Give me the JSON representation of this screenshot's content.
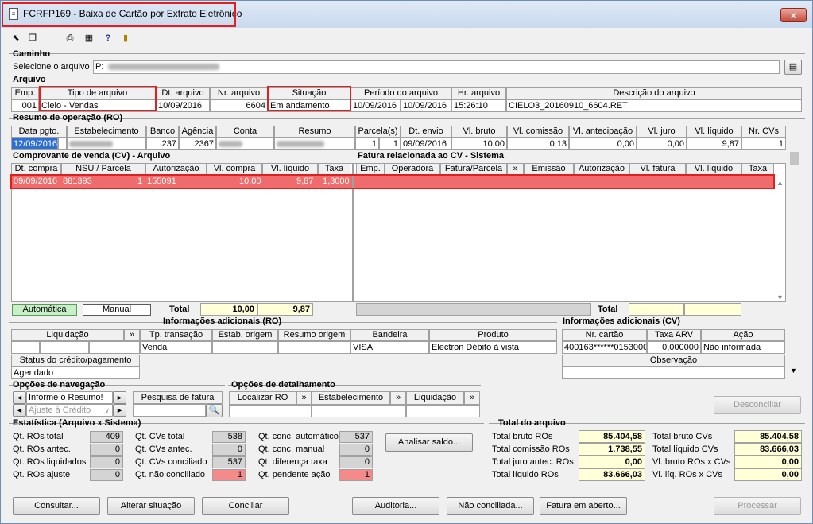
{
  "window": {
    "title": "FCRFP169 - Baixa de Cartão por Extrato Eletrônico",
    "close": "x"
  },
  "caminho": {
    "section": "Caminho",
    "label": "Selecione o arquivo",
    "value": "P:"
  },
  "arquivo": {
    "section": "Arquivo",
    "headers": [
      "Emp.",
      "Tipo de arquivo",
      "Dt. arquivo",
      "Nr. arquivo",
      "Situação",
      "Período do arquivo",
      "Hr. arquivo",
      "Descrição do arquivo"
    ],
    "row": {
      "emp": "001",
      "tipo": "Cielo - Vendas",
      "dt": "10/09/2016",
      "nr": "6604",
      "situacao": "Em andamento",
      "periodo_ini": "10/09/2016",
      "periodo_fim": "10/09/2016",
      "hr": "15:26:10",
      "descricao": "CIELO3_20160910_6604.RET"
    }
  },
  "ro": {
    "section": "Resumo de operação (RO)",
    "headers": [
      "Data pgto.",
      "Estabelecimento",
      "Banco",
      "Agência",
      "Conta",
      "Resumo",
      "Parcela(s)",
      "Dt. envio",
      "Vl. bruto",
      "Vl. comissão",
      "Vl. antecipação",
      "Vl. juro",
      "Vl. líquido",
      "Nr. CVs"
    ],
    "row": {
      "data": "12/09/2016",
      "banco": "237",
      "agencia": "2367",
      "parcela1": "1",
      "parcela2": "1",
      "dt_envio": "09/09/2016",
      "bruto": "10,00",
      "comissao": "0,13",
      "antecipacao": "0,00",
      "juro": "0,00",
      "liquido": "9,87",
      "nr_cvs": "1"
    }
  },
  "cv": {
    "section": "Comprovante de venda (CV) - Arquivo",
    "headers": [
      "Dt. compra",
      "NSU / Parcela",
      "Autorização",
      "Vl. compra",
      "Vl. líquido",
      "Taxa"
    ],
    "row": {
      "dt": "09/09/2016",
      "nsu": "881393",
      "parcela": "1",
      "autorizacao": "155091",
      "compra": "10,00",
      "liquido": "9,87",
      "taxa": "1,3000"
    },
    "automatica": "Automática",
    "manual": "Manual",
    "total_label": "Total",
    "total_compra": "10,00",
    "total_liquido": "9,87"
  },
  "fatura": {
    "section": "Fatura relacionada ao CV - Sistema",
    "headers": [
      "Emp.",
      "Operadora",
      "Fatura/Parcela",
      "»",
      "Emissão",
      "Autorização",
      "Vl. fatura",
      "Vl. líquido",
      "Taxa"
    ],
    "total_label": "Total"
  },
  "info_ro": {
    "section": "Informações adicionais (RO)",
    "headers": [
      "Liquidação",
      "»",
      "Tp. transação",
      "Estab. origem",
      "Resumo origem",
      "Bandeira",
      "Produto"
    ],
    "row": {
      "tp": "Venda",
      "bandeira": "VISA",
      "produto": "Electron Débito à vista"
    },
    "status_label": "Status do crédito/pagamento",
    "status": "Agendado"
  },
  "info_cv": {
    "section": "Informações adicionais (CV)",
    "headers": [
      "Nr. cartão",
      "Taxa ARV",
      "Ação"
    ],
    "row": {
      "cartao": "400163******0153000",
      "taxa": "0,000000",
      "acao": "Não informada"
    },
    "obs_label": "Observação"
  },
  "nav": {
    "section": "Opções de navegação",
    "item1": "Informe o Resumo!",
    "item2": "Ajuste à Crédito",
    "left": "◄",
    "right": "►",
    "pesquisa": "Pesquisa de fatura"
  },
  "det": {
    "section": "Opções de detalhamento",
    "b1": "Localizar RO",
    "b2": "Estabelecimento",
    "b3": "Liquidação",
    "arrow": "»"
  },
  "desconciliar": "Desconciliar",
  "estat": {
    "section": "Estatística (Arquivo x Sistema)",
    "col1": [
      {
        "label": "Qt. ROs total",
        "value": "409"
      },
      {
        "label": "Qt. ROs antec.",
        "value": "0"
      },
      {
        "label": "Qt. ROs liquidados",
        "value": "0"
      },
      {
        "label": "Qt. ROs ajuste",
        "value": "0"
      }
    ],
    "col2": [
      {
        "label": "Qt. CVs total",
        "value": "538"
      },
      {
        "label": "Qt. CVs antec.",
        "value": "0"
      },
      {
        "label": "Qt. CVs conciliado",
        "value": "537"
      },
      {
        "label": "Qt. não conciliado",
        "value": "1"
      }
    ],
    "col3": [
      {
        "label": "Qt. conc. automático",
        "value": "537"
      },
      {
        "label": "Qt. conc. manual",
        "value": "0"
      },
      {
        "label": "Qt. diferença taxa",
        "value": "0"
      },
      {
        "label": "Qt. pendente ação",
        "value": "1"
      }
    ],
    "analisar": "Analisar saldo..."
  },
  "total_arq": {
    "section": "Total do arquivo",
    "left": [
      {
        "label": "Total bruto ROs",
        "value": "85.404,58"
      },
      {
        "label": "Total comissão ROs",
        "value": "1.738,55"
      },
      {
        "label": "Total juro antec. ROs",
        "value": "0,00"
      },
      {
        "label": "Total líquido ROs",
        "value": "83.666,03"
      }
    ],
    "right": [
      {
        "label": "Total bruto CVs",
        "value": "85.404,58"
      },
      {
        "label": "Total líquido CVs",
        "value": "83.666,03"
      },
      {
        "label": "Vl. bruto ROs x CVs",
        "value": "0,00"
      },
      {
        "label": "Vl. líq. ROs x CVs",
        "value": "0,00"
      }
    ]
  },
  "bottom": {
    "consultar": "Consultar...",
    "alterar": "Alterar situação",
    "conciliar": "Conciliar",
    "auditoria": "Auditoria...",
    "nao_conc": "Não conciliada...",
    "fatura": "Fatura em aberto...",
    "processar": "Processar"
  },
  "colors": {
    "selected_row": "#f06b6b",
    "highlight": "#e02020",
    "yellow": "#ffffd8",
    "green": "#c8f0c8"
  }
}
